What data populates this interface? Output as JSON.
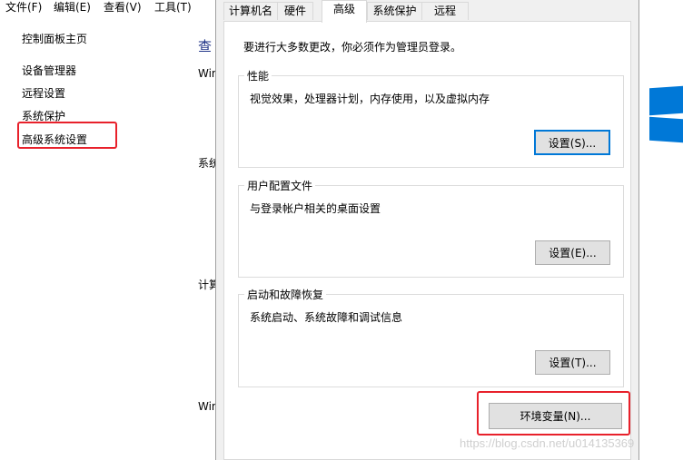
{
  "menubar": {
    "file": "文件(F)",
    "edit": "编辑(E)",
    "view": "查看(V)",
    "tools": "工具(T)"
  },
  "sidebar": {
    "home": "控制面板主页",
    "items": [
      "设备管理器",
      "远程设置",
      "系统保护",
      "高级系统设置"
    ]
  },
  "background": {
    "heading_fragment": "查",
    "fragments": [
      "Win",
      "系统",
      "计算",
      "Win"
    ]
  },
  "dialog": {
    "tabs": [
      "计算机名",
      "硬件",
      "高级",
      "系统保护",
      "远程"
    ],
    "active_tab": "高级",
    "notice": "要进行大多数更改，你必须作为管理员登录。",
    "performance": {
      "title": "性能",
      "description": "视觉效果，处理器计划，内存使用，以及虚拟内存",
      "button": "设置(S)..."
    },
    "user_profiles": {
      "title": "用户配置文件",
      "description": "与登录帐户相关的桌面设置",
      "button": "设置(E)..."
    },
    "startup_recovery": {
      "title": "启动和故障恢复",
      "description": "系统启动、系统故障和调试信息",
      "button": "设置(T)..."
    },
    "env_button": "环境变量(N)..."
  },
  "watermark": "https://blog.csdn.net/u014135369",
  "colors": {
    "highlight": "#e8212b",
    "accent": "#0078d7",
    "dialog_bg": "#f0f0f0"
  }
}
